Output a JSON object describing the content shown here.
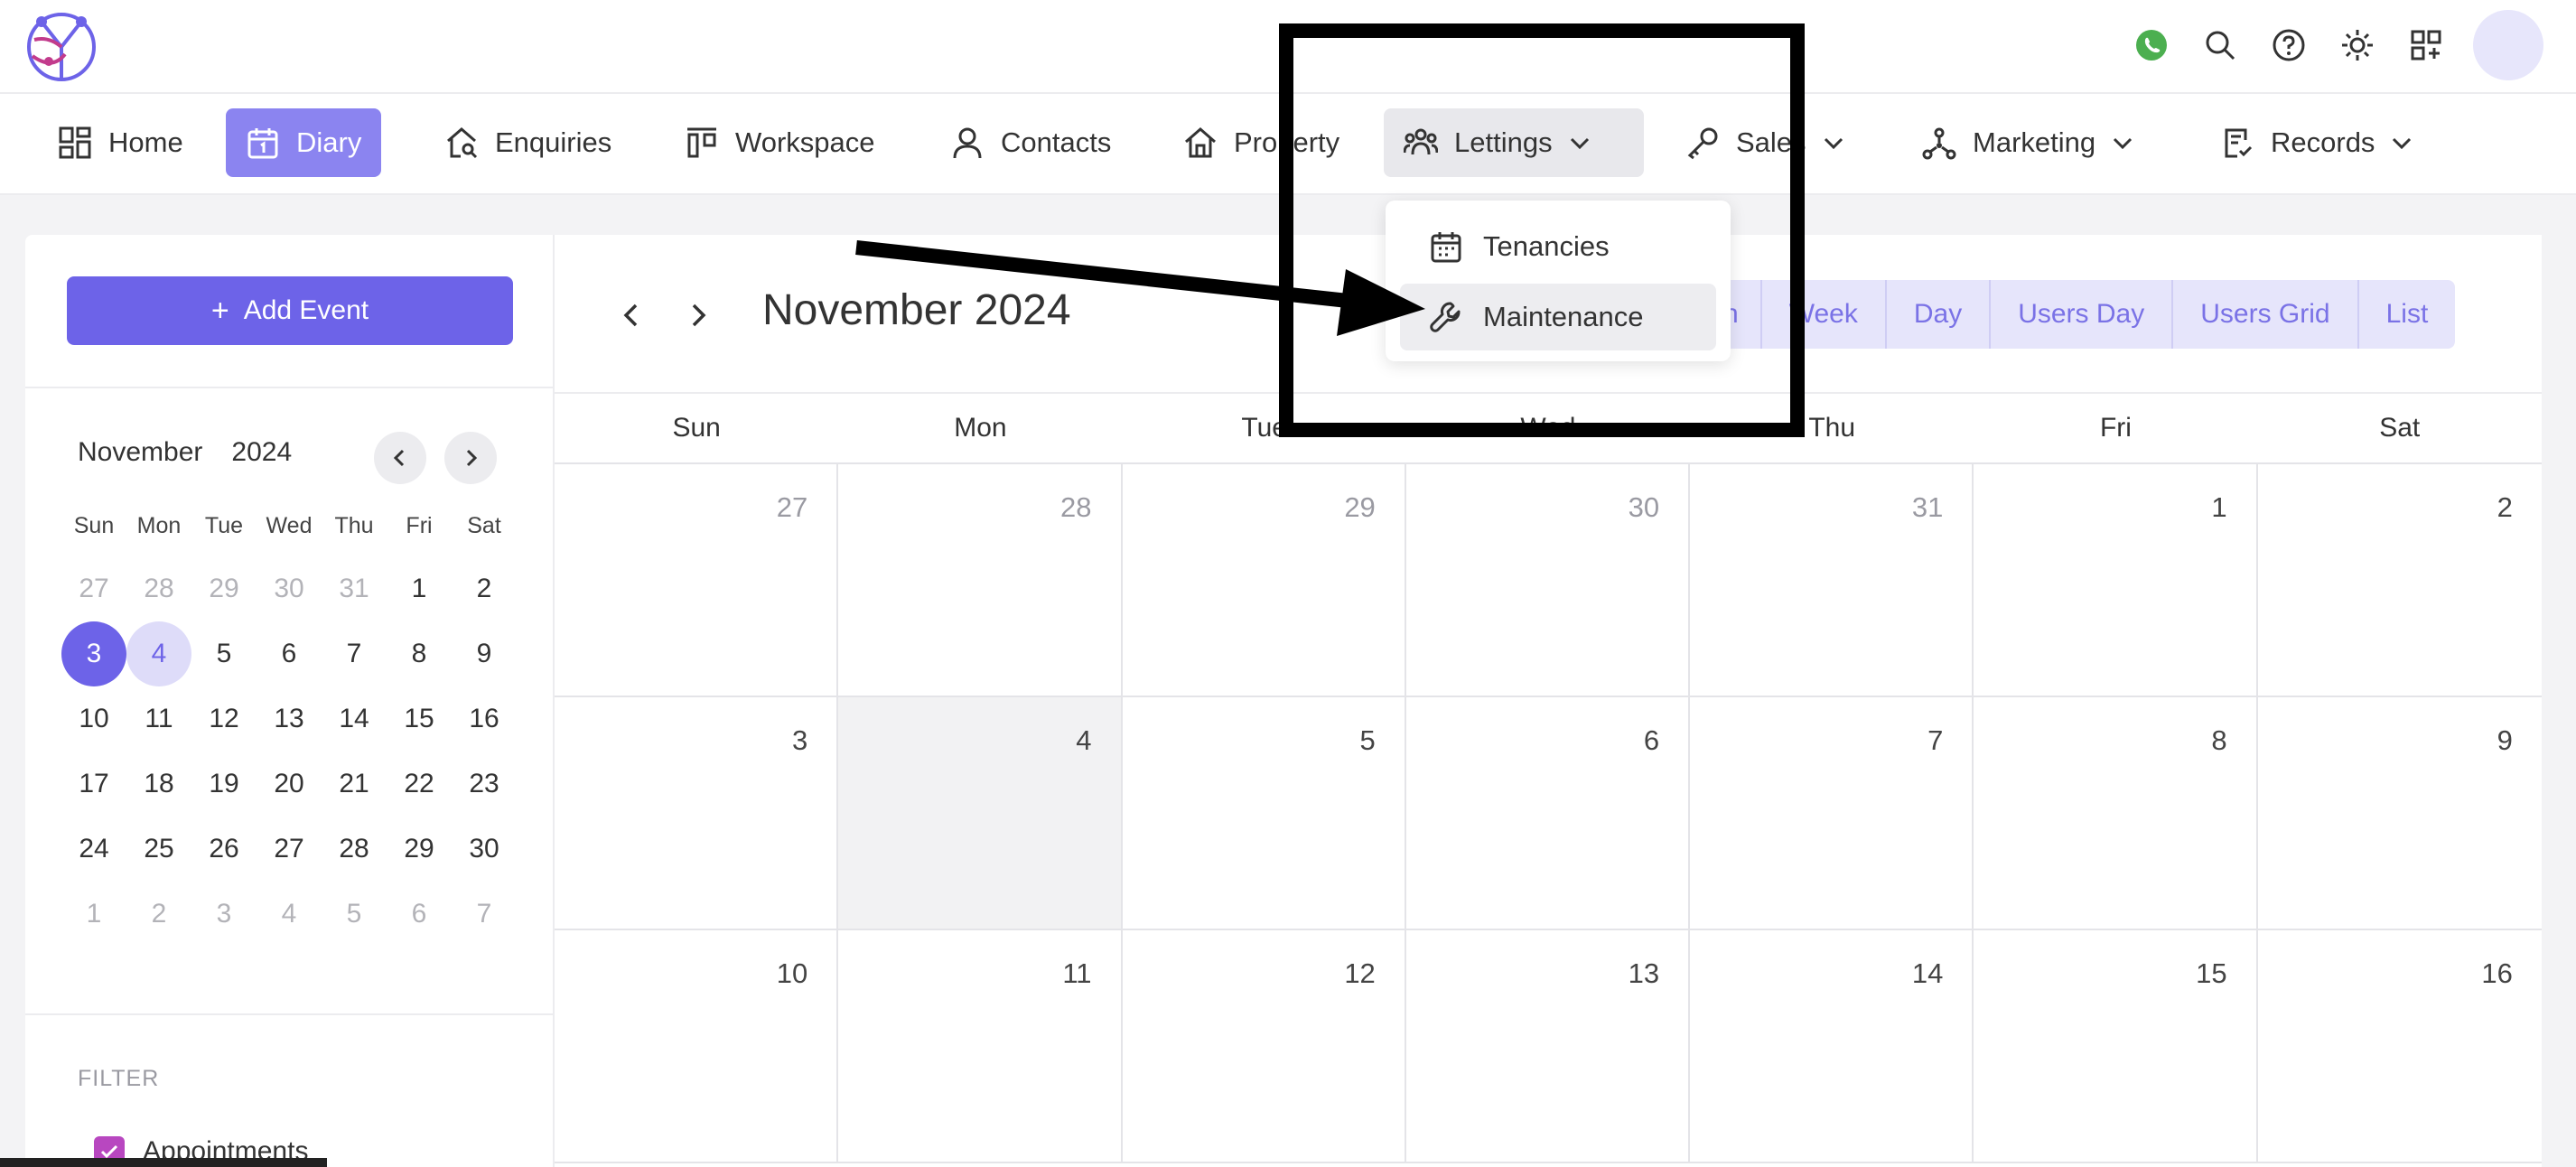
{
  "nav": {
    "items": [
      {
        "label": "Home"
      },
      {
        "label": "Diary"
      },
      {
        "label": "Enquiries"
      },
      {
        "label": "Workspace"
      },
      {
        "label": "Contacts"
      },
      {
        "label": "Property"
      },
      {
        "label": "Lettings"
      },
      {
        "label": "Sales"
      },
      {
        "label": "Marketing"
      },
      {
        "label": "Records"
      }
    ]
  },
  "lettings_menu": {
    "items": [
      {
        "label": "Tenancies",
        "icon": "calendar-icon"
      },
      {
        "label": "Maintenance",
        "icon": "wrench-icon"
      }
    ]
  },
  "sidebar": {
    "add_event_label": "Add Event",
    "mini_month": "November",
    "mini_year": "2024",
    "weekdays": [
      "Sun",
      "Mon",
      "Tue",
      "Wed",
      "Thu",
      "Fri",
      "Sat"
    ],
    "weeks": [
      [
        "27",
        "28",
        "29",
        "30",
        "31",
        "1",
        "2"
      ],
      [
        "3",
        "4",
        "5",
        "6",
        "7",
        "8",
        "9"
      ],
      [
        "10",
        "11",
        "12",
        "13",
        "14",
        "15",
        "16"
      ],
      [
        "17",
        "18",
        "19",
        "20",
        "21",
        "22",
        "23"
      ],
      [
        "24",
        "25",
        "26",
        "27",
        "28",
        "29",
        "30"
      ],
      [
        "1",
        "2",
        "3",
        "4",
        "5",
        "6",
        "7"
      ]
    ],
    "filter_label": "FILTER",
    "filter_items": [
      {
        "label": "Appointments"
      }
    ]
  },
  "calendar": {
    "title": "November 2024",
    "views": [
      "h",
      "Week",
      "Day",
      "Users Day",
      "Users Grid",
      "List"
    ],
    "weekdays": [
      "Sun",
      "Mon",
      "Tue",
      "Wed",
      "Thu",
      "Fri",
      "Sat"
    ],
    "weeks": [
      [
        "27",
        "28",
        "29",
        "30",
        "31",
        "1",
        "2"
      ],
      [
        "3",
        "4",
        "5",
        "6",
        "7",
        "8",
        "9"
      ],
      [
        "10",
        "11",
        "12",
        "13",
        "14",
        "15",
        "16"
      ]
    ]
  },
  "colors": {
    "accent": "#6d63e8",
    "accent_light": "#e6e5fb",
    "whatsapp": "#4caf50",
    "checkbox": "#b847c0"
  }
}
